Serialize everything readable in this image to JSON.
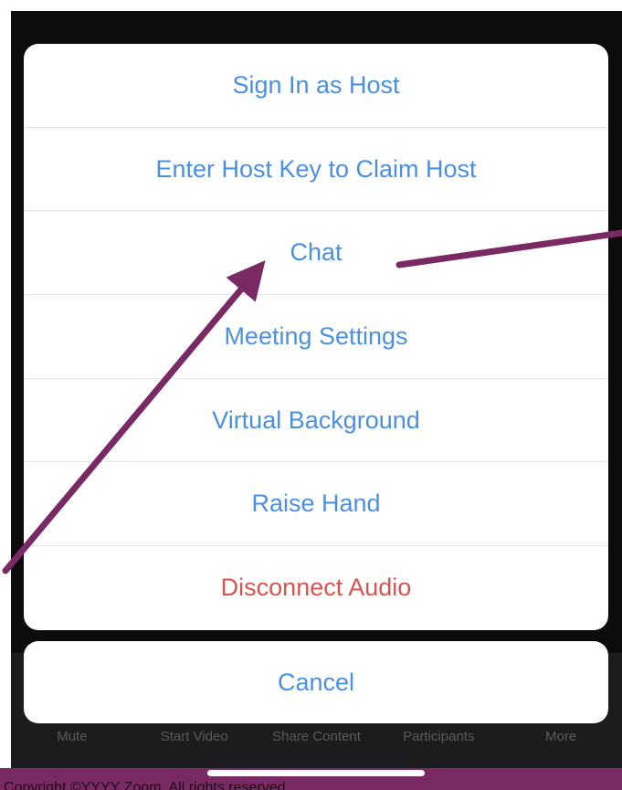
{
  "menu": {
    "items": [
      {
        "label": "Sign In as Host"
      },
      {
        "label": "Enter Host Key to Claim Host"
      },
      {
        "label": "Chat"
      },
      {
        "label": "Meeting Settings"
      },
      {
        "label": "Virtual Background"
      },
      {
        "label": "Raise Hand"
      },
      {
        "label": "Disconnect Audio"
      }
    ],
    "cancel_label": "Cancel"
  },
  "toolbar": {
    "items": [
      "Mute",
      "Start Video",
      "Share Content",
      "Participants",
      "More"
    ]
  },
  "footer": {
    "copyright": "Copyright ©YYYY Zoom. All rights reserved"
  },
  "colors": {
    "action_text": "#4a90e2",
    "destructive_text": "#d9534f",
    "arrow": "#7a2a63",
    "background": "#0c0c0c"
  }
}
